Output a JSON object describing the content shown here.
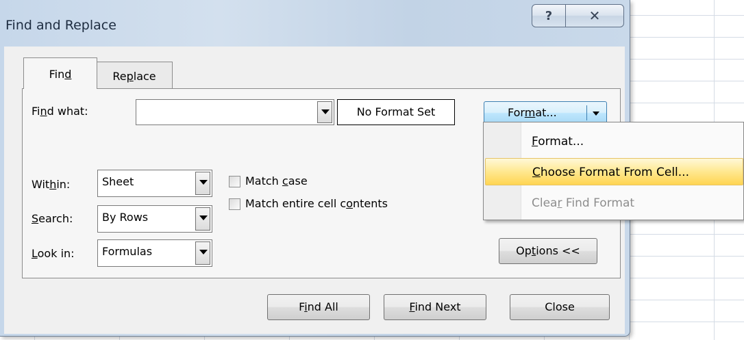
{
  "dialog": {
    "title": "Find and Replace",
    "help_glyph": "?",
    "close_glyph": "✕",
    "tabs": [
      {
        "pre": "Fin",
        "access_key": "d",
        "post": ""
      },
      {
        "pre": "Re",
        "access_key": "p",
        "post": "lace"
      }
    ],
    "find_what": {
      "pre": "Fi",
      "access_key": "n",
      "post": "d what:",
      "value": ""
    },
    "no_format_set": "No Format Set",
    "format_button": {
      "pre": "For",
      "access_key": "m",
      "post": "at..."
    },
    "within": {
      "pre": "Wit",
      "access_key": "h",
      "post": "in:",
      "value": "Sheet"
    },
    "search": {
      "pre": "",
      "access_key": "S",
      "post": "earch:",
      "value": "By Rows"
    },
    "look_in": {
      "pre": "",
      "access_key": "L",
      "post": "ook in:",
      "value": "Formulas"
    },
    "match_case": {
      "pre": "Match ",
      "access_key": "c",
      "post": "ase",
      "checked": false
    },
    "match_entire": {
      "pre": "Match entire cell c",
      "access_key": "o",
      "post": "ntents",
      "checked": false
    },
    "options_button": {
      "pre": "Op",
      "access_key": "t",
      "post": "ions <<"
    },
    "find_all_button": {
      "pre": "F",
      "access_key": "i",
      "post": "nd All"
    },
    "find_next_button": {
      "pre": "",
      "access_key": "F",
      "post": "ind Next"
    },
    "close_button": {
      "label": "Close"
    }
  },
  "format_menu": {
    "items": [
      {
        "pre": "",
        "access_key": "F",
        "post": "ormat...",
        "state": "normal"
      },
      {
        "pre": "",
        "access_key": "C",
        "post": "hoose Format From Cell...",
        "state": "highlighted"
      },
      {
        "pre": "Clea",
        "access_key": "r",
        "post": " Find Format",
        "state": "disabled"
      }
    ]
  }
}
